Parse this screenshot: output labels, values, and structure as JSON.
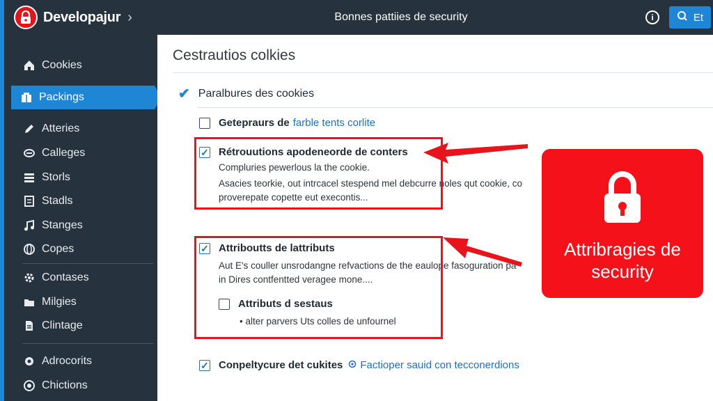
{
  "sidebar": {
    "brand": "Developajur",
    "items": [
      {
        "label": "Cookies",
        "icon": "home-icon"
      },
      {
        "label": "Packings",
        "icon": "package-icon",
        "active": true
      },
      {
        "label": "Atteries",
        "icon": "pencil-icon"
      },
      {
        "label": "Calleges",
        "icon": "link-icon"
      },
      {
        "label": "Storls",
        "icon": "stack-icon"
      },
      {
        "label": "Stadls",
        "icon": "document-icon"
      },
      {
        "label": "Stanges",
        "icon": "music-icon"
      },
      {
        "label": "Copes",
        "icon": "globe-icon"
      },
      {
        "label": "Contases",
        "icon": "gear-icon"
      },
      {
        "label": "Milgies",
        "icon": "folder-icon"
      },
      {
        "label": "Clintage",
        "icon": "file-icon"
      },
      {
        "label": "Adrocorits",
        "icon": "cog-icon"
      },
      {
        "label": "Chictions",
        "icon": "settings-icon"
      }
    ]
  },
  "topbar": {
    "title": "Bonnes pattiies de security",
    "info": "i",
    "search_label": "Et"
  },
  "main": {
    "title": "Cestrautios colkies",
    "section": "Paralbures des cookies",
    "option1": {
      "label": "Getepraurs de",
      "link": "farble tents corlite",
      "checked": false
    },
    "option2": {
      "label": "Rétrouutions apodeneorde de conters",
      "desc1": "Compluries pewerlous la the cookie.",
      "desc2": "Asacies teorkie, out intrcacel stespend mel debcurre noles qut cookie, co",
      "desc3": "proverepate copette eut execontis...",
      "checked": true
    },
    "option3": {
      "label": "Attriboutts de lattributs",
      "desc1": "Aut E's couller unsrodangne refvactions de the eaulope fasoguration pa",
      "desc2": "in Dires contfentted veragee mone....",
      "checked": true,
      "sub": {
        "label": "Attributs d sestaus",
        "bullet": "• alter parvers Uts colles de unfournel",
        "checked": false
      }
    },
    "option4": {
      "label": "Conpeltycure det cukites",
      "link": "Factioper sauid con tecconerdions",
      "link_icon": "settings-icon",
      "checked": true
    }
  },
  "callout": {
    "text_line1": "Attribragies de",
    "text_line2": "security",
    "icon": "lock-icon"
  },
  "colors": {
    "sidebar_bg": "#26323e",
    "accent": "#1f86d6",
    "annotation_red": "#e9141b"
  }
}
